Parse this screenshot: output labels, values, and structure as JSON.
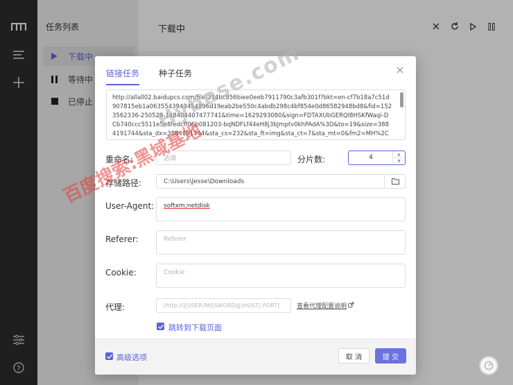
{
  "app": {
    "logo_icon": "motrix-m-icon",
    "accent": "#5b63d6"
  },
  "tasklist": {
    "title": "任务列表",
    "items": [
      {
        "label": "下载中",
        "icon": "play-icon",
        "active": true
      },
      {
        "label": "等待中",
        "icon": "pause-icon",
        "active": false
      },
      {
        "label": "已停止",
        "icon": "stop-icon",
        "active": false
      }
    ]
  },
  "main": {
    "title": "下载中"
  },
  "dialog": {
    "tabs": [
      "链接任务",
      "种子任务"
    ],
    "url": "http://allall02.baidupcs.com/file/314bc856biee0eeb7911790c3afb301f?bkt=en-cf7b18a7c51d907815eb1a0635543943454896d19eab2be550c4abdb298c4bf854e0d86582948bd8&fid=1523562336-250528-148404407477741&time=1629293080&sign=FDTAXUbGERQl8HSKfWaqi-DCb740ccc5511e5e8fedcff06b081203-bqNDFLf44eH8j3bJmptv0khPAdA%3D&to=19&size=3884191744&sta_dx=3884191744&sta_cs=232&sta_ft=img&sta_ct=7&sta_mt=0&fm2=MH%2CXian%2CAnywhere%2C%2Ctianjin%2Ccnc&ctime=158",
    "rename_label": "重命名:",
    "rename_placeholder": "选填",
    "split_label": "分片数:",
    "split_value": "4",
    "path_label": "存储路径:",
    "path_value": "C:\\Users\\Jesse\\Downloads",
    "ua_label": "User-Agent:",
    "ua_value": "softxm;netdisk",
    "referer_label": "Referer:",
    "referer_placeholder": "Referer",
    "cookie_label": "Cookie:",
    "cookie_placeholder": "Cookie",
    "proxy_label": "代理:",
    "proxy_placeholder": "[http://][USER:PASSWORD@]HOST[:PORT]",
    "proxy_link": "查看代理配置说明",
    "jump_label": "跳转到下载页面",
    "advanced_label": "高级选项",
    "cancel_label": "取 消",
    "submit_label": "提 交"
  },
  "watermark": {
    "red": "百度搜索:黑域基地",
    "grey": "Hybase.com"
  }
}
